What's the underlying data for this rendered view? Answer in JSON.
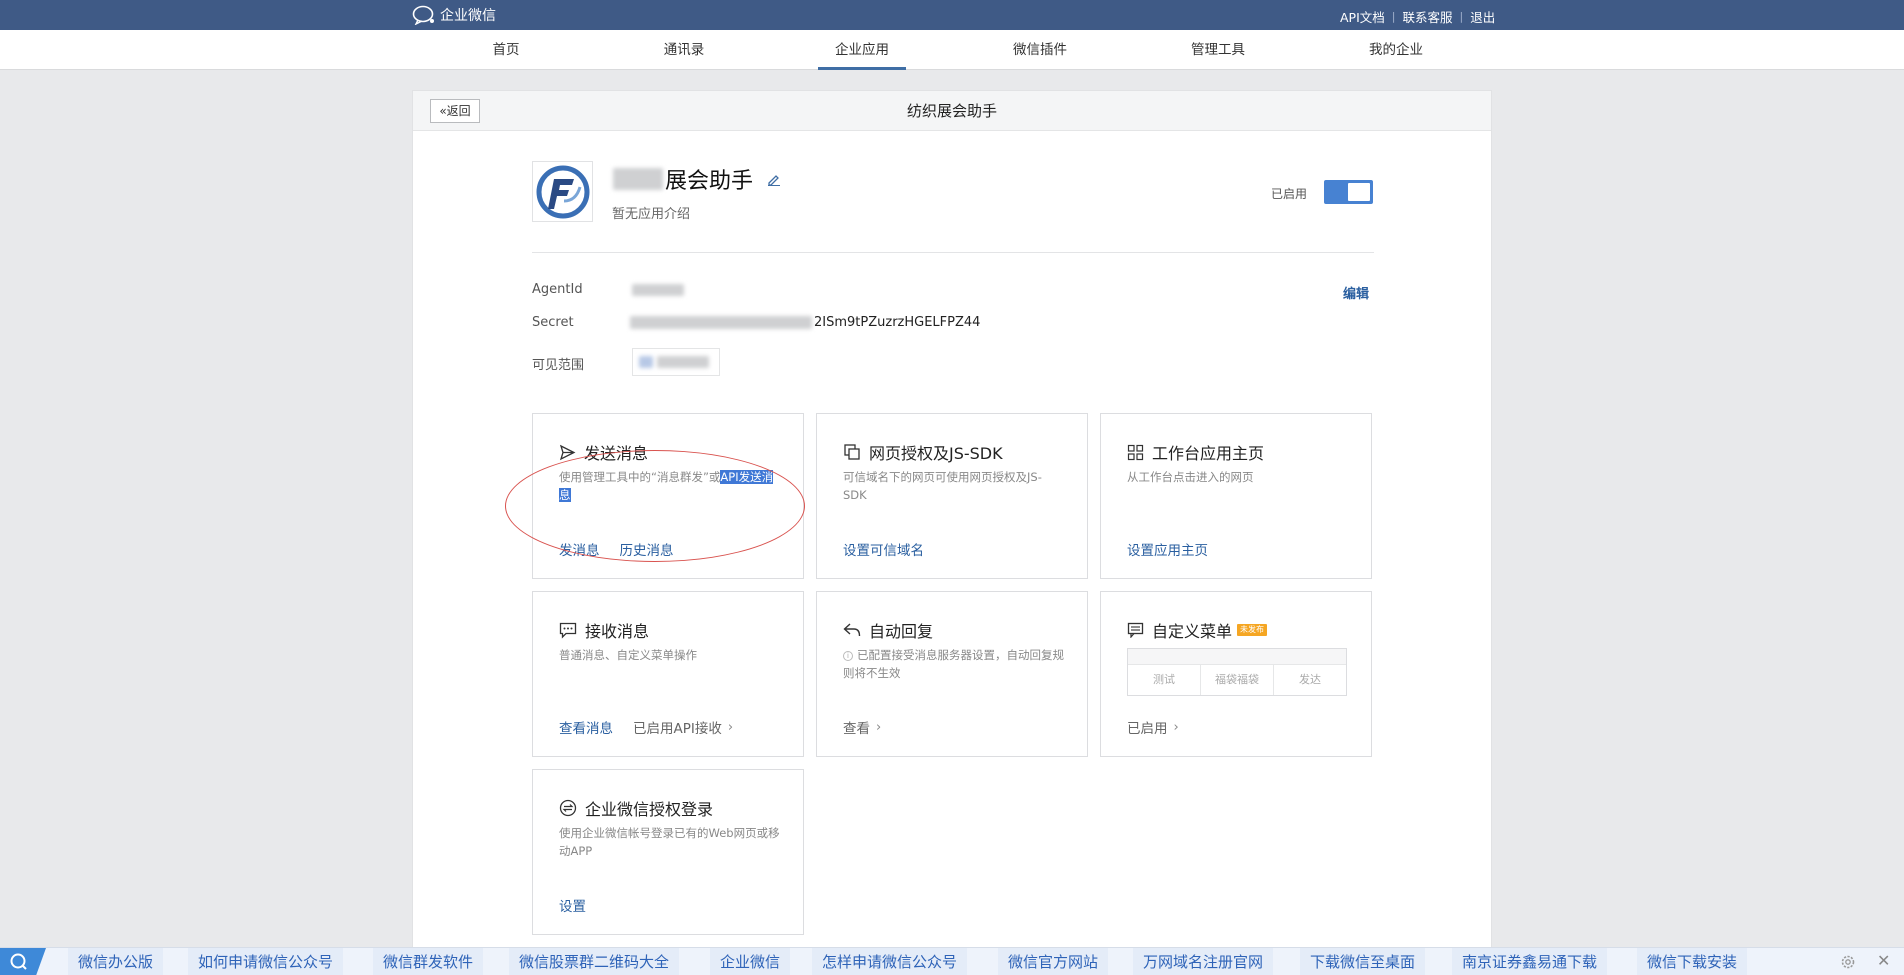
{
  "topbar": {
    "brand": "企业微信",
    "links": [
      "API文档",
      "联系客服",
      "退出"
    ]
  },
  "nav": {
    "items": [
      "首页",
      "通讯录",
      "企业应用",
      "微信插件",
      "管理工具",
      "我的企业"
    ],
    "active": "企业应用"
  },
  "panel": {
    "back_label": "返回",
    "title": "纺织展会助手"
  },
  "app": {
    "name_visible": "展会助手",
    "description": "暂无应用介绍",
    "status_label": "已启用",
    "enabled": true
  },
  "info": {
    "agentid_label": "AgentId",
    "secret_label": "Secret",
    "secret_visible_suffix": "2ISm9tPZuzrzHGELFPZ44",
    "scope_label": "可见范围",
    "edit_label": "编辑"
  },
  "features": {
    "send": {
      "title": "发送消息",
      "desc_prefix": "使用管理工具中的“消息群发”或",
      "desc_highlight_1": "API发送消",
      "desc_highlight_2": "息",
      "action_1": "发消息",
      "action_2": "历史消息"
    },
    "web_auth": {
      "title": "网页授权及JS-SDK",
      "desc": "可信域名下的网页可使用网页授权及JS-SDK",
      "action_1": "设置可信域名"
    },
    "workbench": {
      "title": "工作台应用主页",
      "desc": "从工作台点击进入的网页",
      "action_1": "设置应用主页"
    },
    "receive": {
      "title": "接收消息",
      "desc": "普通消息、自定义菜单操作",
      "action_1": "查看消息",
      "action_2": "已启用API接收"
    },
    "auto_reply": {
      "title": "自动回复",
      "desc": "已配置接受消息服务器设置，自动回复规则将不生效",
      "action_1": "查看"
    },
    "custom_menu": {
      "title": "自定义菜单",
      "badge": "未发布",
      "menu_items": [
        "测试",
        "福袋福袋",
        "发达"
      ],
      "action_1": "已启用"
    },
    "sso": {
      "title": "企业微信授权登录",
      "desc": "使用企业微信帐号登录已有的Web网页或移动APP",
      "action_1": "设置"
    }
  },
  "bottombar": {
    "items": [
      "微信办公版",
      "如何申请微信公众号",
      "微信群发软件",
      "微信股票群二维码大全",
      "企业微信",
      "怎样申请微信公众号",
      "微信官方网站",
      "万网域名注册官网",
      "下载微信至桌面",
      "南京证券鑫易通下载",
      "微信下载安装"
    ]
  },
  "colors": {
    "topbar": "#3f5a86",
    "link": "#2a5fa0",
    "toggle": "#4782d2",
    "annotation": "#d9534f",
    "badge": "#f5a623"
  }
}
